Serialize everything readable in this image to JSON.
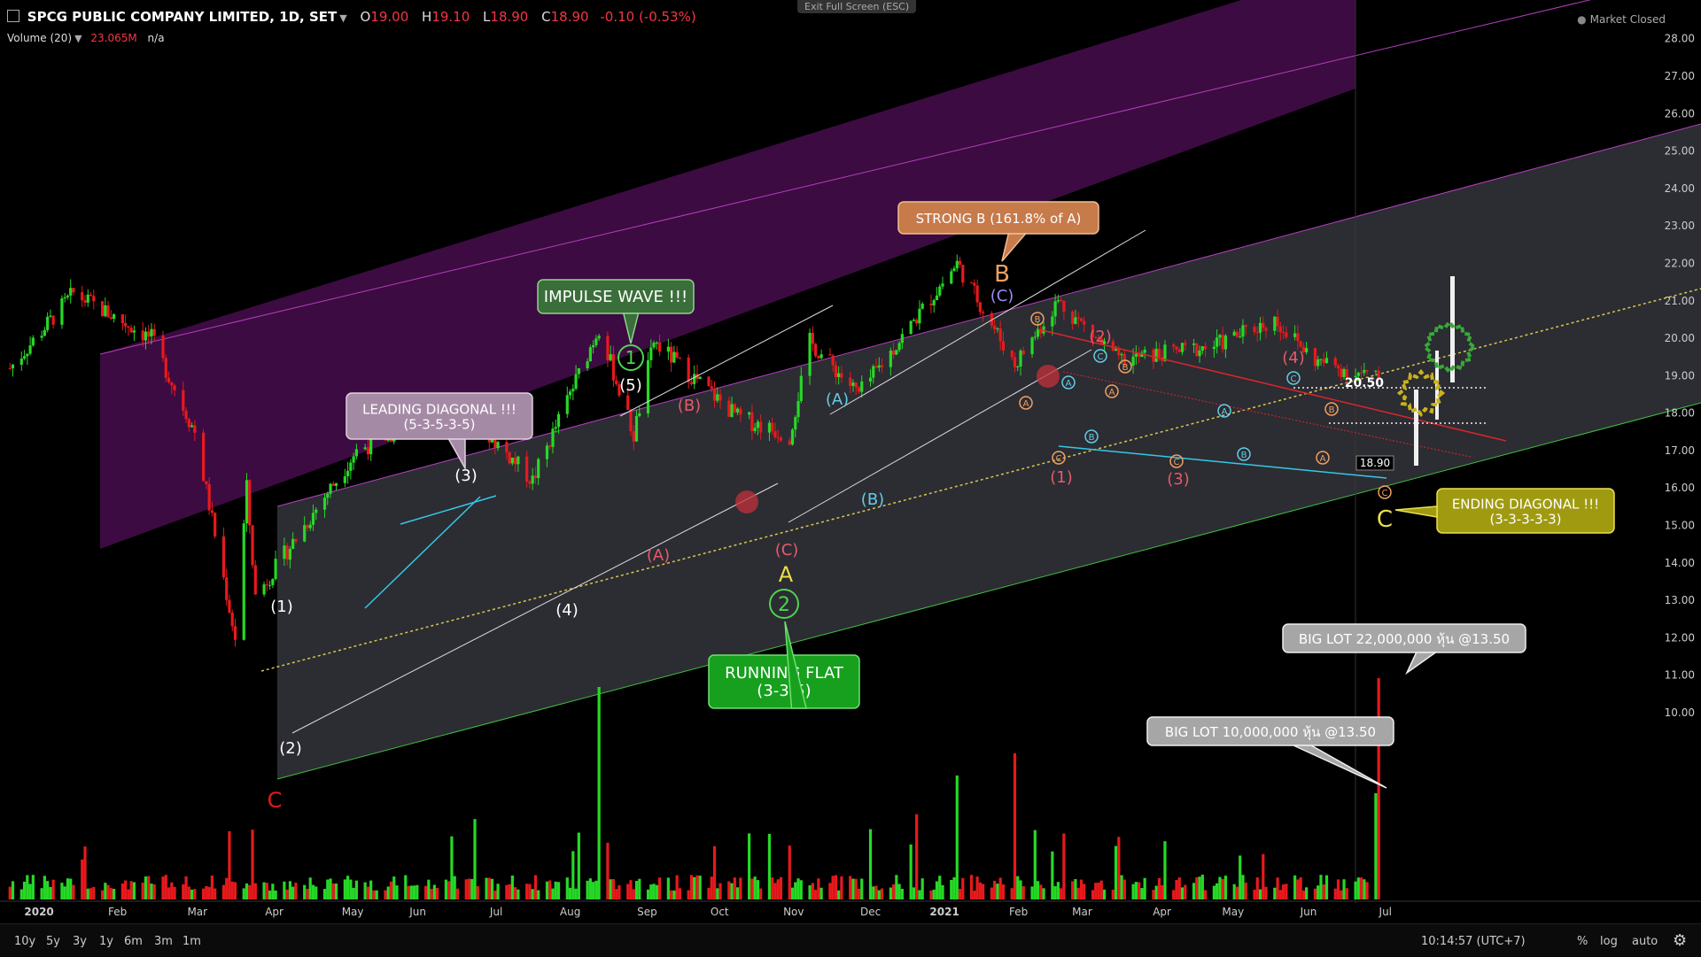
{
  "header": {
    "symbol": "SPCG PUBLIC COMPANY LIMITED, 1D, SET",
    "o_label": "O",
    "o": "19.00",
    "h_label": "H",
    "h": "19.10",
    "l_label": "L",
    "l": "18.90",
    "c_label": "C",
    "c": "18.90",
    "change": "-0.10 (-0.53%)"
  },
  "volume_legend": {
    "label": "Volume (20)",
    "value": "23.065M",
    "ma": "n/a"
  },
  "exit_fullscreen": "Exit Full Screen (ESC)",
  "market_status": "Market Closed",
  "last_price_tag": "18.90",
  "price_axis_labels": [
    "28.00",
    "27.00",
    "26.00",
    "25.00",
    "24.00",
    "23.00",
    "22.00",
    "21.00",
    "20.00",
    "19.00",
    "18.00",
    "17.00",
    "16.00",
    "15.00",
    "14.00",
    "13.00",
    "12.00",
    "11.00",
    "10.00"
  ],
  "time_axis_labels": [
    "2020",
    "Feb",
    "Mar",
    "Apr",
    "May",
    "Jun",
    "Jul",
    "Aug",
    "Sep",
    "Oct",
    "Nov",
    "Dec",
    "2021",
    "Feb",
    "Mar",
    "Apr",
    "May",
    "Jun",
    "Jul"
  ],
  "annotations": {
    "leading_diagonal": [
      "LEADING DIAGONAL !!!",
      "(5-3-5-3-5)"
    ],
    "impulse": "IMPULSE WAVE !!!",
    "strong_b": "STRONG B (161.8% of A)",
    "running_flat": [
      "RUNNING FLAT",
      "(3-3-5)"
    ],
    "ending_diagonal": [
      "ENDING DIAGONAL !!!",
      "(3-3-3-3-3)"
    ],
    "big_lot_1": "BIG LOT 22,000,000 หุ้น @13.50",
    "big_lot_2": "BIG LOT 10,000,000 หุ้น @13.50",
    "level_20_50": "20.50"
  },
  "wave_labels": {
    "C_red": "C",
    "w1": "(1)",
    "w2": "(2)",
    "w3": "(3)",
    "w4": "(4)",
    "w5": "(5)",
    "circ1": "1",
    "circ2": "2",
    "A_open": "(A)",
    "B_open": "(B)",
    "C_open": "(C)",
    "A_big": "A",
    "B_big": "B",
    "C_big": "C",
    "A_cyan": "(A)",
    "B_cyan": "(B)",
    "C_purple": "(C)",
    "r1": "(1)",
    "r2": "(2)",
    "r3": "(3)",
    "r4": "(4)",
    "small_a": "A",
    "small_b": "B",
    "small_c": "C"
  },
  "colors": {
    "up": "#26d926",
    "down": "#e8191c",
    "channel_purple": "#4a0f4f",
    "channel_gray": "#3a3a44",
    "impulse_bg": "#3a6e3a",
    "strong_b_bg": "#c77a4a",
    "running_flat_bg": "#16a01e",
    "ending_diag_bg": "#a09a10",
    "leading_diag_bg": "#a58aa6",
    "big_lot_bg": "#a6a6a6"
  },
  "bottom_bar": {
    "ranges": [
      "10y",
      "5y",
      "3y",
      "1y",
      "6m",
      "3m",
      "1m"
    ],
    "clock": "10:14:57 (UTC+7)",
    "options": [
      "%",
      "log",
      "auto"
    ]
  },
  "chart_data": {
    "type": "candlestick",
    "title": "SPCG PUBLIC COMPANY LIMITED, 1D, SET",
    "ylim": [
      9.5,
      28.5
    ],
    "price_path_keypoints": [
      {
        "date": "2020-01-02",
        "price": 19.2
      },
      {
        "date": "2020-01-24",
        "price": 21.2
      },
      {
        "date": "2020-02-20",
        "price": 20.0
      },
      {
        "date": "2020-03-06",
        "price": 17.5
      },
      {
        "date": "2020-03-20",
        "price": 12.0
      },
      {
        "date": "2020-03-24",
        "price": 16.0
      },
      {
        "date": "2020-03-27",
        "price": 13.1
      },
      {
        "date": "2020-05-01",
        "price": 17.0
      },
      {
        "date": "2020-06-05",
        "price": 18.3
      },
      {
        "date": "2020-07-01",
        "price": 16.2
      },
      {
        "date": "2020-07-24",
        "price": 20.3
      },
      {
        "date": "2020-08-05",
        "price": 17.4
      },
      {
        "date": "2020-08-12",
        "price": 19.9
      },
      {
        "date": "2020-09-10",
        "price": 17.9
      },
      {
        "date": "2020-09-28",
        "price": 17.4
      },
      {
        "date": "2020-10-05",
        "price": 19.9
      },
      {
        "date": "2020-10-22",
        "price": 18.5
      },
      {
        "date": "2020-11-25",
        "price": 22.0
      },
      {
        "date": "2020-12-15",
        "price": 19.3
      },
      {
        "date": "2020-12-30",
        "price": 21.0
      },
      {
        "date": "2021-01-20",
        "price": 19.4
      },
      {
        "date": "2021-02-22",
        "price": 19.8
      },
      {
        "date": "2021-03-15",
        "price": 20.5
      },
      {
        "date": "2021-03-29",
        "price": 19.4
      },
      {
        "date": "2021-04-20",
        "price": 18.9
      }
    ],
    "volume_note": "Volume spikes near 2020-07-24 and 2021-04-20 (BIG LOT)"
  }
}
